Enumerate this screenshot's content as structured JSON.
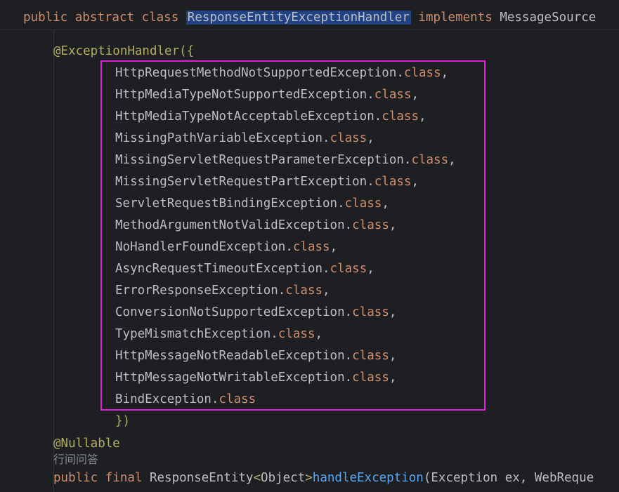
{
  "sticky_header": {
    "modifiers": "public abstract class ",
    "class_name": "ResponseEntityExceptionHandler",
    "implements_kw": " implements ",
    "interface_name": "MessageSource"
  },
  "annotation_open": {
    "annotation": "@ExceptionHandler",
    "brace": "({"
  },
  "exceptions": [
    {
      "name": "HttpRequestMethodNotSupportedException",
      "suffix": ".",
      "kw": "class",
      "tail": ","
    },
    {
      "name": "HttpMediaTypeNotSupportedException",
      "suffix": ".",
      "kw": "class",
      "tail": ","
    },
    {
      "name": "HttpMediaTypeNotAcceptableException",
      "suffix": ".",
      "kw": "class",
      "tail": ","
    },
    {
      "name": "MissingPathVariableException",
      "suffix": ".",
      "kw": "class",
      "tail": ","
    },
    {
      "name": "MissingServletRequestParameterException",
      "suffix": ".",
      "kw": "class",
      "tail": ","
    },
    {
      "name": "MissingServletRequestPartException",
      "suffix": ".",
      "kw": "class",
      "tail": ","
    },
    {
      "name": "ServletRequestBindingException",
      "suffix": ".",
      "kw": "class",
      "tail": ","
    },
    {
      "name": "MethodArgumentNotValidException",
      "suffix": ".",
      "kw": "class",
      "tail": ","
    },
    {
      "name": "NoHandlerFoundException",
      "suffix": ".",
      "kw": "class",
      "tail": ","
    },
    {
      "name": "AsyncRequestTimeoutException",
      "suffix": ".",
      "kw": "class",
      "tail": ","
    },
    {
      "name": "ErrorResponseException",
      "suffix": ".",
      "kw": "class",
      "tail": ","
    },
    {
      "name": "ConversionNotSupportedException",
      "suffix": ".",
      "kw": "class",
      "tail": ","
    },
    {
      "name": "TypeMismatchException",
      "suffix": ".",
      "kw": "class",
      "tail": ","
    },
    {
      "name": "HttpMessageNotReadableException",
      "suffix": ".",
      "kw": "class",
      "tail": ","
    },
    {
      "name": "HttpMessageNotWritableException",
      "suffix": ".",
      "kw": "class",
      "tail": ","
    },
    {
      "name": "BindException",
      "suffix": ".",
      "kw": "class",
      "tail": ""
    }
  ],
  "annotation_close": "})",
  "nullable_annotation": "@Nullable",
  "inlay_hint": "行间问答",
  "method_signature": {
    "modifiers": "public final ",
    "return_type": "ResponseEntity",
    "generic_open": "<",
    "generic_type": "Object",
    "generic_close": ">",
    "method_name": "handleException",
    "params": "(Exception ex, WebReque"
  },
  "colors": {
    "background": "#1e1f22",
    "keyword": "#cf8e6d",
    "annotation": "#b3ae60",
    "method": "#56a8f5",
    "text": "#bcbec4",
    "selection": "#214283",
    "highlight_box": "#e020d8"
  }
}
